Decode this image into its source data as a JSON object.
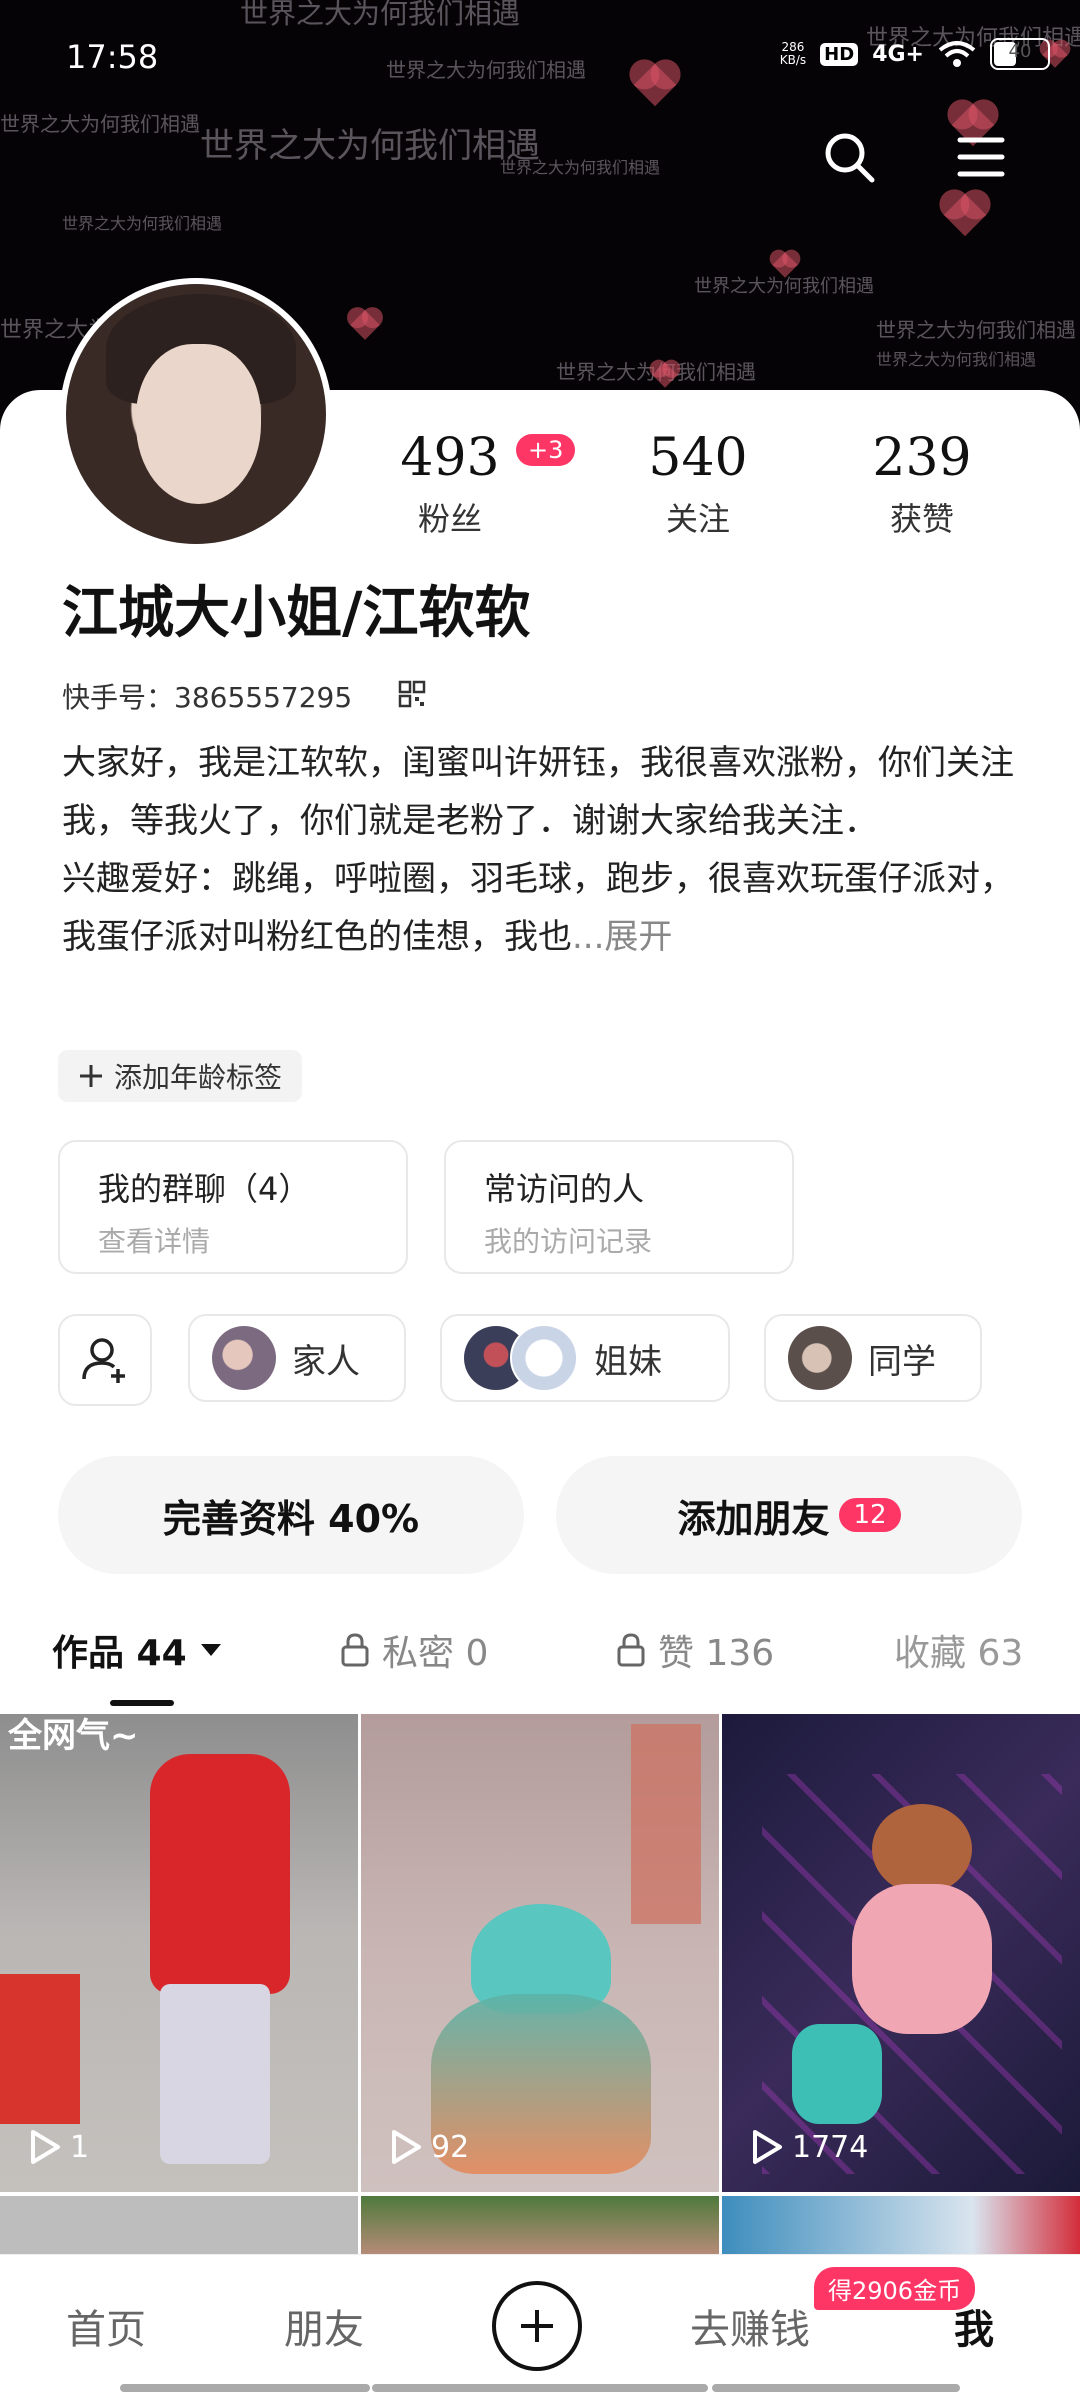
{
  "status_bar": {
    "time": "17:58",
    "speed_value": "286",
    "speed_unit": "KB/s",
    "hd": "HD",
    "network": "4G+",
    "battery": "40"
  },
  "banner": {
    "repeated_text": "世界之大为何我们相遇"
  },
  "profile": {
    "name": "江城大小姐/江软软",
    "kuaishou_id": "快手号：3865557295",
    "bio_line1": "大家好，我是江软软，闺蜜叫许妍钰，我很喜欢涨粉，你们关注我，等我火了，你们就是老粉了．谢谢大家给我关注．",
    "bio_line2": "兴趣爱好：跳绳，呼啦圈，羽毛球，跑步，很喜欢玩蛋仔派对，我蛋仔派对叫粉红色的佳想，我也",
    "expand": "...展开",
    "age_tag": "添加年龄标签"
  },
  "stats": [
    {
      "value": "493",
      "label": "粉丝",
      "badge": "+3"
    },
    {
      "value": "540",
      "label": "关注"
    },
    {
      "value": "239",
      "label": "获赞"
    }
  ],
  "boxes": [
    {
      "title": "我的群聊（4）",
      "subtitle": "查看详情"
    },
    {
      "title": "常访问的人",
      "subtitle": "我的访问记录"
    }
  ],
  "chips": [
    {
      "label": "家人"
    },
    {
      "label": "姐妹"
    },
    {
      "label": "同学"
    }
  ],
  "actions": {
    "complete_profile": "完善资料 40%",
    "add_friends": "添加朋友",
    "add_friends_count": "12"
  },
  "tabs": [
    {
      "label": "作品 44"
    },
    {
      "label": "私密 0"
    },
    {
      "label": "赞 136"
    },
    {
      "label": "收藏 63"
    }
  ],
  "videos": [
    {
      "plays": "1",
      "overlay_text": "全网气~"
    },
    {
      "plays": "92"
    },
    {
      "plays": "1774"
    }
  ],
  "nav": {
    "home": "首页",
    "friends": "朋友",
    "earn": "去赚钱",
    "me": "我",
    "earn_badge": "得2906金币"
  },
  "colors": {
    "accent": "#fe3666",
    "banner_bg": "#050305"
  }
}
